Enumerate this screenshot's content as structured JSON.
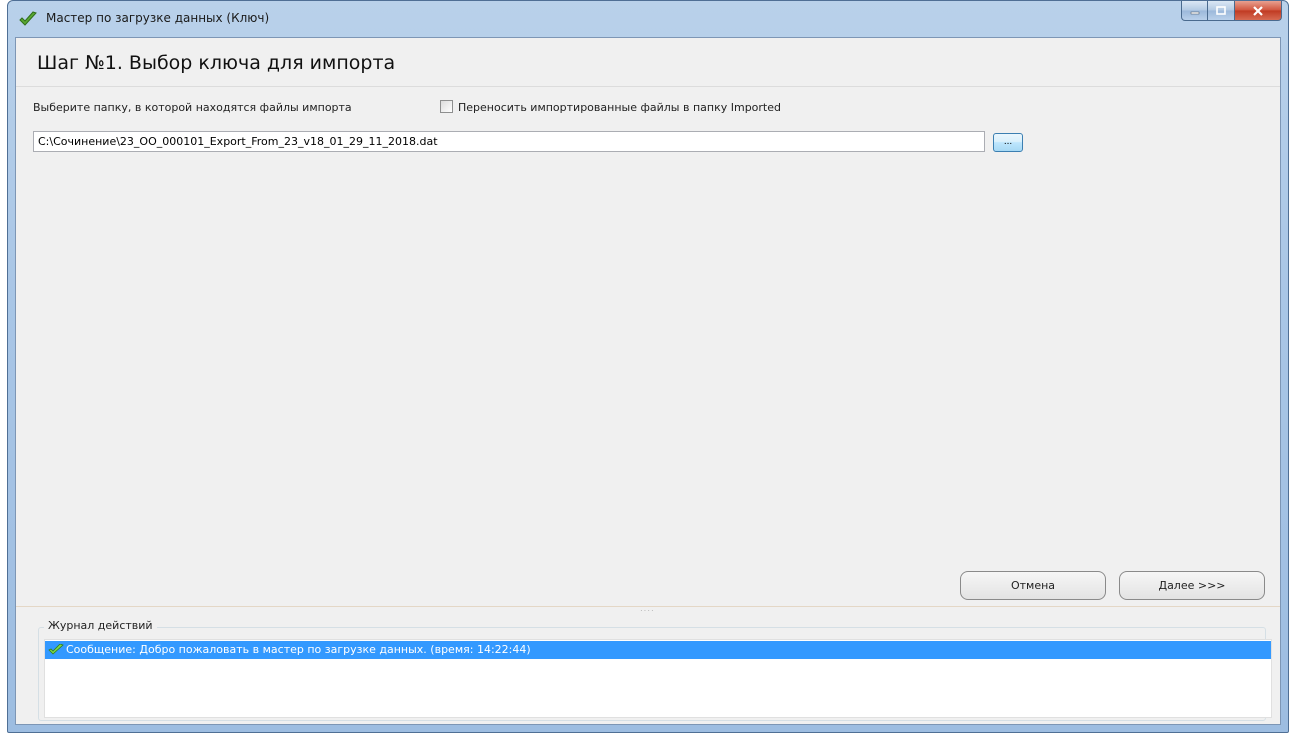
{
  "window": {
    "title": "Мастер по загрузке данных (Ключ)",
    "icon": "checkmark-icon"
  },
  "step": {
    "title": "Шаг №1.  Выбор ключа для импорта"
  },
  "form": {
    "folder_label": "Выберите папку, в которой находятся файлы импорта",
    "move_checkbox_label": "Переносить импортированные файлы в папку Imported",
    "move_checkbox_checked": false,
    "path_value": "C:\\Сочинение\\23_OO_000101_Export_From_23_v18_01_29_11_2018.dat",
    "browse_label": "..."
  },
  "buttons": {
    "cancel": "Отмена",
    "next": "Далее >>>"
  },
  "log": {
    "title": "Журнал действий",
    "entries": [
      {
        "icon": "checkmark-icon",
        "text": "Сообщение: Добро пожаловать в мастер по загрузке данных. (время: 14:22:44)",
        "selected": true
      }
    ]
  },
  "colors": {
    "selection": "#3399ff",
    "titlebar": "#b9d1ea",
    "close_button": "#c03a22"
  }
}
